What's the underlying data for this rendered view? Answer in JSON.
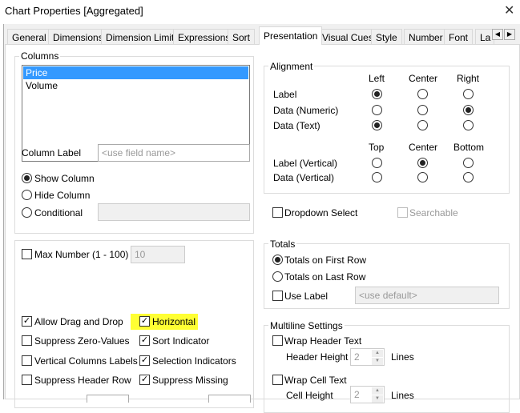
{
  "window": {
    "title": "Chart Properties [Aggregated]",
    "close": "✕"
  },
  "tabs": [
    "General",
    "Dimensions",
    "Dimension Limits",
    "Expressions",
    "Sort",
    "Presentation",
    "Visual Cues",
    "Style",
    "Number",
    "Font",
    "La"
  ],
  "active_tab": "Presentation",
  "columns": {
    "group": "Columns",
    "items": [
      "Price",
      "Volume"
    ],
    "selected": "Price",
    "column_label": "Column Label",
    "column_label_placeholder": "<use field name>",
    "show": "Show Column",
    "hide": "Hide Column",
    "conditional": "Conditional",
    "visibility": "Show Column"
  },
  "alignment": {
    "group": "Alignment",
    "h_headers": [
      "Left",
      "Center",
      "Right"
    ],
    "h_rows": [
      {
        "label": "Label",
        "value": "Left"
      },
      {
        "label": "Data (Numeric)",
        "value": "Right"
      },
      {
        "label": "Data (Text)",
        "value": "Left"
      }
    ],
    "v_headers": [
      "Top",
      "Center",
      "Bottom"
    ],
    "v_rows": [
      {
        "label": "Label (Vertical)",
        "value": "Center"
      },
      {
        "label": "Data (Vertical)",
        "value": ""
      }
    ]
  },
  "dropdown_select": {
    "label": "Dropdown Select",
    "checked": false
  },
  "searchable": {
    "label": "Searchable",
    "checked": false
  },
  "max_number": {
    "label": "Max Number (1 - 100)",
    "value": "10",
    "checked": false
  },
  "totals": {
    "group": "Totals",
    "first": "Totals on First Row",
    "last": "Totals on Last Row",
    "selected": "first",
    "use_label": "Use Label",
    "use_label_placeholder": "<use default>"
  },
  "options": {
    "allow_drag": "Allow Drag and Drop",
    "horizontal": "Horizontal",
    "suppress_zero": "Suppress Zero-Values",
    "sort_indicator": "Sort Indicator",
    "vertical_labels": "Vertical Columns Labels",
    "selection_indicators": "Selection Indicators",
    "suppress_header": "Suppress Header Row",
    "suppress_missing": "Suppress Missing"
  },
  "multiline": {
    "group": "Multiline Settings",
    "wrap_header": "Wrap Header Text",
    "header_height": "Header Height",
    "header_value": "2",
    "wrap_cell": "Wrap Cell Text",
    "cell_height": "Cell Height",
    "cell_value": "2",
    "lines": "Lines"
  },
  "colors": {
    "highlight": "#ffff33",
    "selection": "#3399ff"
  }
}
